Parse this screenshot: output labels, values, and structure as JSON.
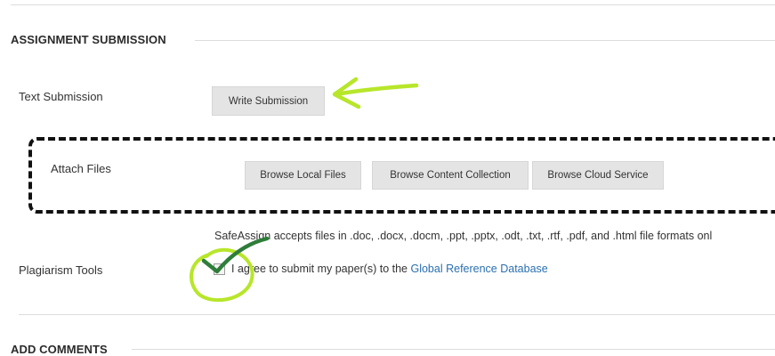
{
  "assignment_submission": {
    "title": "ASSIGNMENT SUBMISSION",
    "text_submission": {
      "label": "Text Submission",
      "write_button": "Write Submission"
    },
    "attach_files": {
      "label": "Attach Files",
      "browse_local": "Browse Local Files",
      "browse_content": "Browse Content Collection",
      "browse_cloud": "Browse Cloud Service"
    },
    "plagiarism": {
      "label": "Plagiarism Tools",
      "note": "SafeAssign accepts files in .doc, .docx, .docm, .ppt, .pptx, .odt, .txt, .rtf, .pdf, and .html file formats onl",
      "agree_text": "I agree to submit my paper(s) to the ",
      "agree_link": "Global Reference Database",
      "checked": true
    }
  },
  "add_comments": {
    "title": "ADD COMMENTS"
  },
  "annotation_colors": {
    "arrow": "#b7e62a",
    "circle": "#b7e62a",
    "check": "#2e7d3a"
  }
}
